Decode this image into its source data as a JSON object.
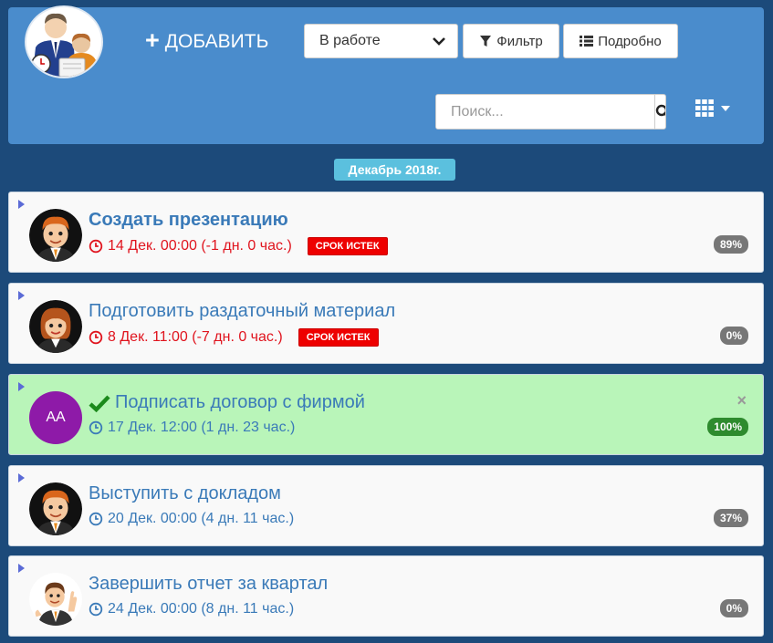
{
  "header": {
    "add_label": "ДОБАВИТЬ",
    "status_value": "В работе",
    "filter_label": "Фильтр",
    "details_label": "Подробно",
    "search_placeholder": "Поиск..."
  },
  "month_label": "Декабрь 2018г.",
  "tasks": [
    {
      "title": "Создать презентацию",
      "datetime": "14 Дек. 00:00 (-1 дн. 0 час.)",
      "badge": "СРОК ИСТЕК",
      "percent": "89%",
      "avatar": "man-avatar"
    },
    {
      "title": "Подготовить раздаточный материал",
      "datetime": "8 Дек. 11:00 (-7 дн. 0 час.)",
      "badge": "СРОК ИСТЕК",
      "percent": "0%",
      "avatar": "woman-avatar"
    },
    {
      "title": "Подписать договор с фирмой",
      "datetime": "17 Дек. 12:00 (1 дн. 23 час.)",
      "percent": "100%",
      "initials": "AA"
    },
    {
      "title": "Выступить с докладом",
      "datetime": "20 Дек. 00:00 (4 дн. 11 час.)",
      "percent": "37%",
      "avatar": "man-avatar"
    },
    {
      "title": "Завершить отчет за квартал",
      "datetime": "24 Дек. 00:00 (8 дн. 11 час.)",
      "percent": "0%",
      "avatar": "businessman-avatar"
    }
  ],
  "colors": {
    "header_bg": "#4a8ccc",
    "page_bg": "#1c4a7a",
    "title_blue": "#3a7ab8",
    "overdue_red": "#e0141e",
    "done_bg": "#b9f5b9",
    "month_badge": "#5bc0de"
  }
}
